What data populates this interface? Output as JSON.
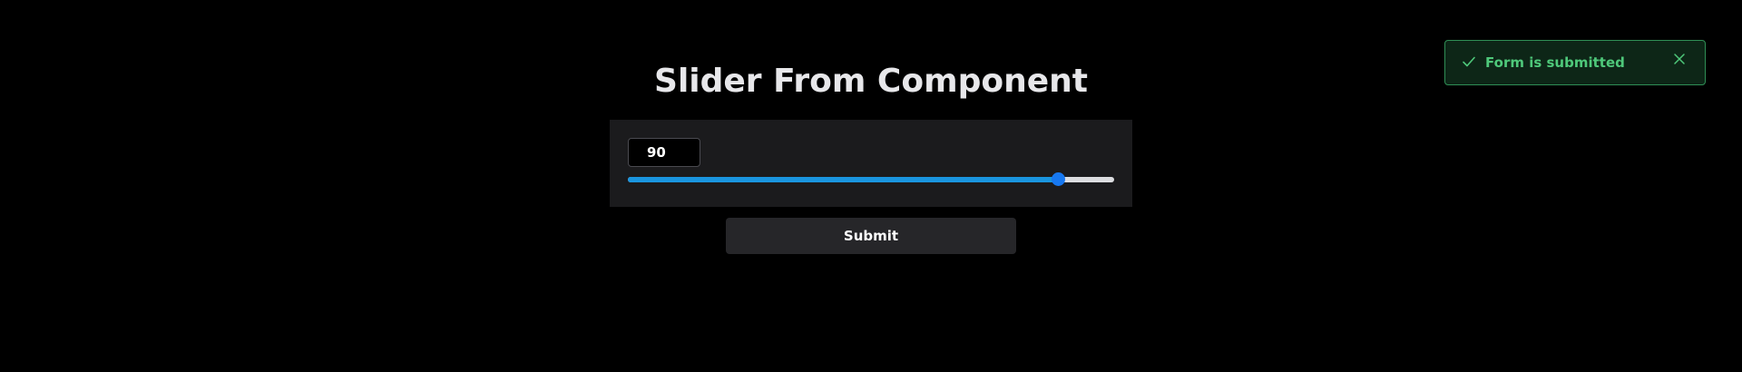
{
  "page": {
    "title": "Slider From Component"
  },
  "slider_form": {
    "value": "90",
    "slider_value": 90,
    "slider_min": 0,
    "slider_max": 100,
    "submit_label": "Submit"
  },
  "toast": {
    "message": "Form is submitted",
    "icon": "check-icon",
    "close_icon": "close-icon"
  },
  "colors": {
    "background": "#000000",
    "panel": "#1b1b1d",
    "slider_fill": "#1a95df",
    "slider_thumb": "#1778f0",
    "toast_text": "#4ec87a",
    "toast_border": "#2f8f55"
  }
}
